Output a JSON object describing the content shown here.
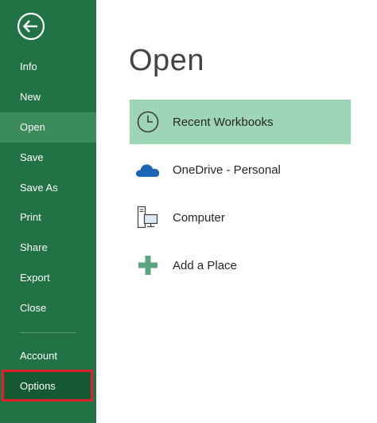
{
  "sidebar": {
    "back_label": "Back",
    "items": [
      {
        "label": "Info"
      },
      {
        "label": "New"
      },
      {
        "label": "Open"
      },
      {
        "label": "Save"
      },
      {
        "label": "Save As"
      },
      {
        "label": "Print"
      },
      {
        "label": "Share"
      },
      {
        "label": "Export"
      },
      {
        "label": "Close"
      },
      {
        "label": "Account"
      },
      {
        "label": "Options"
      }
    ],
    "active": "Open",
    "highlighted": "Options"
  },
  "main": {
    "title": "Open",
    "places": [
      {
        "label": "Recent Workbooks",
        "icon": "clock-icon",
        "selected": true
      },
      {
        "label": "OneDrive - Personal",
        "icon": "cloud-icon",
        "selected": false
      },
      {
        "label": "Computer",
        "icon": "computer-icon",
        "selected": false
      },
      {
        "label": "Add a Place",
        "icon": "plus-icon",
        "selected": false
      }
    ]
  },
  "colors": {
    "sidebar_bg": "#217346",
    "active_item_bg": "#3b8c5c",
    "selected_place_bg": "#9fd5b7",
    "highlight_border": "#e0202a",
    "cloud_blue": "#1e64b4",
    "plus_green": "#5aa57e"
  }
}
